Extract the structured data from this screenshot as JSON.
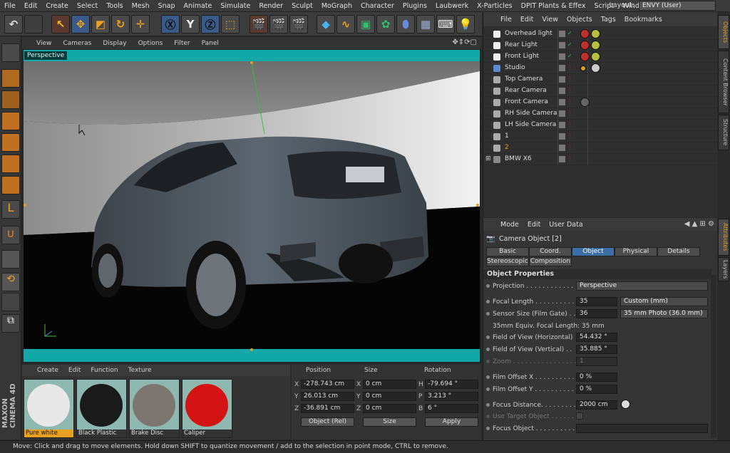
{
  "menubar": {
    "items": [
      "File",
      "Edit",
      "Create",
      "Select",
      "Tools",
      "Mesh",
      "Snap",
      "Animate",
      "Simulate",
      "Render",
      "Sculpt",
      "MoGraph",
      "Character",
      "Plugins",
      "Laubwerk",
      "X-Particles",
      "DPIT Plants & Effex",
      "Script",
      "Window"
    ],
    "layout_label": "Layout:",
    "layout_value": "ENVY (User)"
  },
  "viewport": {
    "menu": [
      "View",
      "Cameras",
      "Display",
      "Options",
      "Filter",
      "Panel"
    ],
    "camera_label": "Perspective"
  },
  "materials": {
    "menu": [
      "Create",
      "Edit",
      "Function",
      "Texture"
    ],
    "items": [
      {
        "label": "Pure white"
      },
      {
        "label": "Black Plastic"
      },
      {
        "label": "Brake Disc"
      },
      {
        "label": "Caliper"
      }
    ]
  },
  "coords": {
    "headers": [
      "Position",
      "Size",
      "Rotation"
    ],
    "rows": [
      {
        "axis": "X",
        "pos": "-278.743 cm",
        "size_axis": "X",
        "size": "0 cm",
        "rot_axis": "H",
        "rot": "-79.694 °"
      },
      {
        "axis": "Y",
        "pos": "26.013 cm",
        "size_axis": "Y",
        "size": "0 cm",
        "rot_axis": "P",
        "rot": "3.213 °"
      },
      {
        "axis": "Z",
        "pos": "-36.891 cm",
        "size_axis": "Z",
        "size": "0 cm",
        "rot_axis": "B",
        "rot": "6 °"
      }
    ],
    "mode": "Object (Rel)",
    "size_mode": "Size",
    "apply": "Apply"
  },
  "status": "Move: Click and drag to move elements. Hold down SHIFT to quantize movement / add to the selection in point mode, CTRL to remove.",
  "objects": {
    "menu": [
      "File",
      "Edit",
      "View",
      "Objects",
      "Tags",
      "Bookmarks"
    ],
    "rows": [
      {
        "name": "Overhead light"
      },
      {
        "name": "Rear Light"
      },
      {
        "name": "Front Light"
      },
      {
        "name": "Studio"
      },
      {
        "name": "Top Camera"
      },
      {
        "name": "Rear Camera"
      },
      {
        "name": "Front Camera"
      },
      {
        "name": "RH Side Camera"
      },
      {
        "name": "LH Side Camera"
      },
      {
        "name": "1"
      },
      {
        "name": "2"
      },
      {
        "name": "BMW X6"
      }
    ]
  },
  "attributes": {
    "menu": [
      "Mode",
      "Edit",
      "User Data"
    ],
    "title": "Camera Object [2]",
    "tabs": [
      "Basic",
      "Coord.",
      "Object",
      "Physical",
      "Details",
      "Stereoscopic",
      "Composition"
    ],
    "section": "Object Properties",
    "projection_label": "Projection . . . . . . . . . . . . .",
    "projection": "Perspective",
    "focal_label": "Focal Length . . . . . . . . . . .",
    "focal": "35",
    "focal_preset": "Custom (mm)",
    "sensor_label": "Sensor Size (Film Gate) . . .",
    "sensor": "36",
    "sensor_preset": "35 mm Photo (36.0 mm)",
    "equiv": "35mm Equiv. Focal Length: 35 mm",
    "fovh_label": "Field of View (Horizontal)",
    "fovh": "54.432 °",
    "fovv_label": "Field of View (Vertical) . .",
    "fovv": "35.885 °",
    "zoom_label": "Zoom . . . . . . . . . . . . . . . .",
    "zoom": "1",
    "filmx_label": "Film Offset X . . . . . . . . . .",
    "filmx": "0 %",
    "filmy_label": "Film Offset Y . . . . . . . . . .",
    "filmy": "0 %",
    "focus_label": "Focus Distance. . . . . . . . .",
    "focus": "2000 cm",
    "usetarget_label": "Use Target Object . . . . . .",
    "focusobj_label": "Focus Object . . . . . . . . . ."
  },
  "sidetabs": [
    "Objects",
    "Content Browser",
    "Structure",
    "Attributes",
    "Layers"
  ],
  "colors": {
    "accent": "#3a6ea5",
    "teal": "#12a8a8",
    "material_label_active": "#e8a020"
  }
}
